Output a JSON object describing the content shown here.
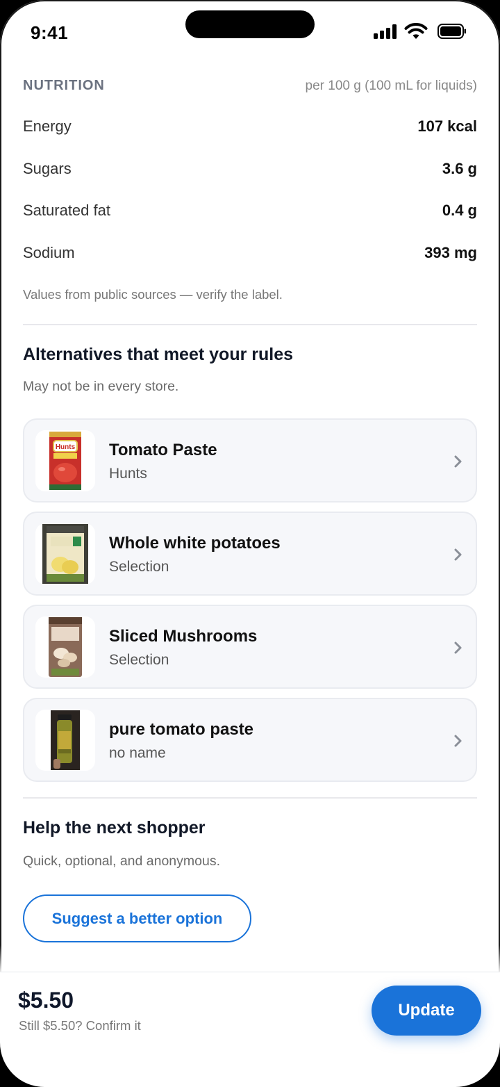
{
  "status_bar": {
    "time": "9:41"
  },
  "nutrition": {
    "title": "NUTRITION",
    "basis": "per 100 g (100 mL for liquids)",
    "rows": [
      {
        "label": "Energy",
        "value": "107 kcal"
      },
      {
        "label": "Sugars",
        "value": "3.6 g"
      },
      {
        "label": "Saturated fat",
        "value": "0.4 g"
      },
      {
        "label": "Sodium",
        "value": "393 mg"
      }
    ],
    "note": "Values from public sources — verify the label."
  },
  "alternatives": {
    "title": "Alternatives that meet your rules",
    "subtitle": "May not be in every store.",
    "items": [
      {
        "name": "Tomato Paste",
        "brand": "Hunts"
      },
      {
        "name": "Whole white potatoes",
        "brand": "Selection"
      },
      {
        "name": "Sliced Mushrooms",
        "brand": "Selection"
      },
      {
        "name": "pure tomato paste",
        "brand": "no name"
      }
    ]
  },
  "help": {
    "title": "Help the next shopper",
    "subtitle": "Quick, optional, and anonymous.",
    "suggest_label": "Suggest a better option"
  },
  "bottom_bar": {
    "price": "$5.50",
    "price_note": "Still $5.50? Confirm it",
    "update_label": "Update"
  },
  "colors": {
    "accent": "#1a73d9",
    "card_bg": "#f6f7fa"
  },
  "icons": [
    "signal-icon",
    "wifi-icon",
    "battery-icon",
    "chevron-right-icon"
  ]
}
